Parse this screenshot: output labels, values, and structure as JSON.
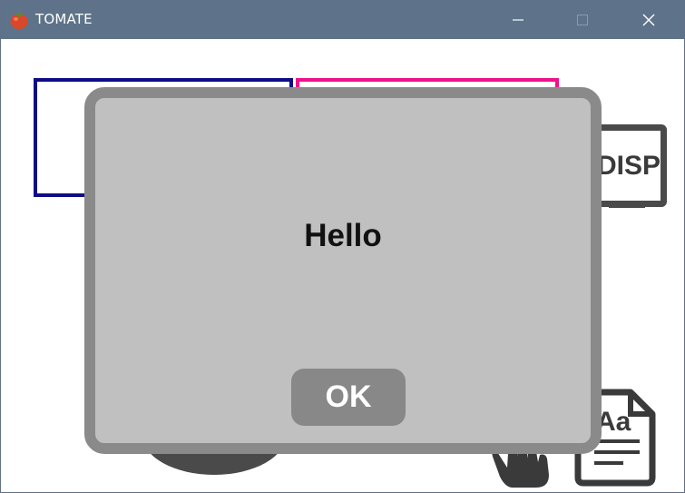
{
  "window": {
    "title": "TOMATE",
    "controls": {
      "minimize": "minimize-icon",
      "maximize": "maximize-icon",
      "close": "close-icon"
    },
    "titlebar_color": "#5e7389"
  },
  "background": {
    "display_tile": {
      "label": "DISP",
      "icon": "display-icon"
    },
    "blue_box_color": "#0f0c86",
    "pink_box_color": "#f0128b",
    "hand_icon": "hand-pointer-icon",
    "document_icon": "font-document-icon",
    "document_label": "Aa"
  },
  "dialog": {
    "message": "Hello",
    "ok_label": "OK",
    "background_color": "#c0c0c0",
    "border_color": "#8a8a8a",
    "button_color": "#888888"
  }
}
